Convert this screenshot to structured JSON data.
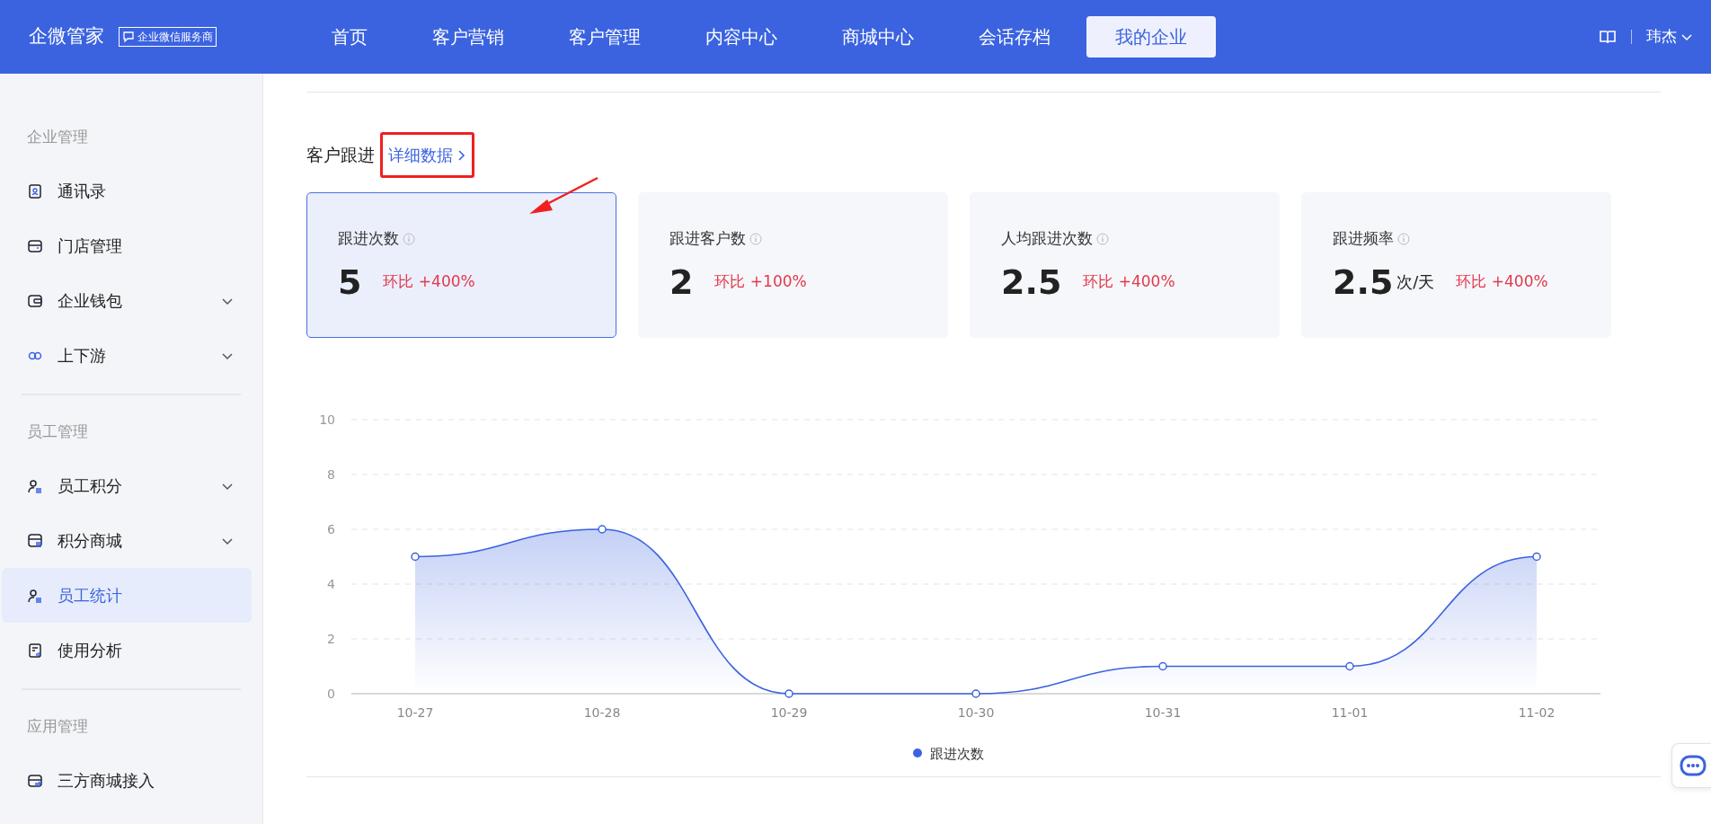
{
  "nav": {
    "logo": "企微管家",
    "badge": "企业微信服务商",
    "items": [
      {
        "label": "首页",
        "selected": false
      },
      {
        "label": "客户营销",
        "selected": false
      },
      {
        "label": "客户管理",
        "selected": false
      },
      {
        "label": "内容中心",
        "selected": false
      },
      {
        "label": "商城中心",
        "selected": false
      },
      {
        "label": "会话存档",
        "selected": false
      },
      {
        "label": "我的企业",
        "selected": true
      }
    ],
    "user": "玮杰"
  },
  "sidebar": {
    "sections": [
      {
        "title": "企业管理",
        "items": [
          {
            "label": "通讯录",
            "selected": false,
            "expandable": false
          },
          {
            "label": "门店管理",
            "selected": false,
            "expandable": false
          },
          {
            "label": "企业钱包",
            "selected": false,
            "expandable": true
          },
          {
            "label": "上下游",
            "selected": false,
            "expandable": true
          }
        ]
      },
      {
        "title": "员工管理",
        "items": [
          {
            "label": "员工积分",
            "selected": false,
            "expandable": true
          },
          {
            "label": "积分商城",
            "selected": false,
            "expandable": true
          },
          {
            "label": "员工统计",
            "selected": true,
            "expandable": false
          },
          {
            "label": "使用分析",
            "selected": false,
            "expandable": false
          }
        ]
      },
      {
        "title": "应用管理",
        "items": [
          {
            "label": "三方商城接入",
            "selected": false,
            "expandable": false
          }
        ]
      }
    ]
  },
  "section": {
    "title": "客户跟进",
    "link": "详细数据"
  },
  "cards": [
    {
      "label": "跟进次数",
      "value": "5",
      "compare": "环比 +400%",
      "selected": true
    },
    {
      "label": "跟进客户数",
      "value": "2",
      "compare": "环比 +100%",
      "selected": false
    },
    {
      "label": "人均跟进次数",
      "value": "2.5",
      "compare": "环比 +400%",
      "selected": false
    },
    {
      "label": "跟进频率",
      "value": "2.5",
      "unit": "次/天",
      "compare": "环比 +400%",
      "selected": false
    }
  ],
  "chart_data": {
    "type": "area",
    "categories": [
      "10-27",
      "10-28",
      "10-29",
      "10-30",
      "10-31",
      "11-01",
      "11-02"
    ],
    "series": [
      {
        "name": "跟进次数",
        "color": "#3b63e0",
        "values": [
          5,
          6,
          0,
          0,
          1,
          1,
          5
        ]
      }
    ],
    "grid": true,
    "ylim": [
      0,
      10
    ],
    "yticks": [
      0,
      2,
      4,
      6,
      8,
      10
    ]
  }
}
